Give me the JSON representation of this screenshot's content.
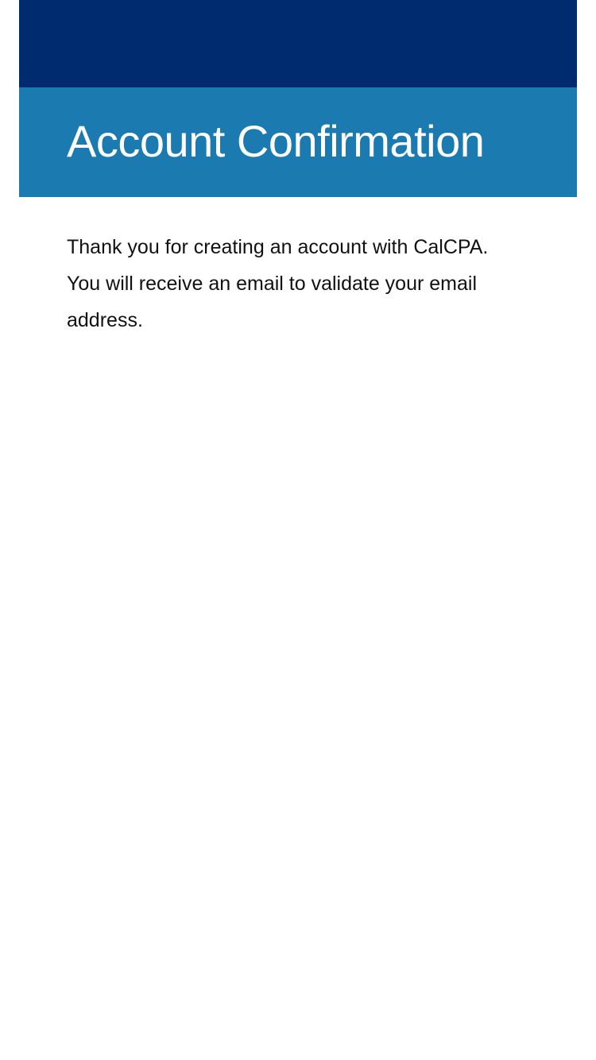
{
  "header": {
    "title": "Account Confirmation"
  },
  "main": {
    "message": "Thank you for creating an account with CalCPA. You will receive an email to validate your email address."
  },
  "colors": {
    "top_banner": "#002b6e",
    "title_band": "#1b7bb1",
    "title_text": "#ffffff",
    "body_text": "#111111",
    "background": "#ffffff"
  }
}
